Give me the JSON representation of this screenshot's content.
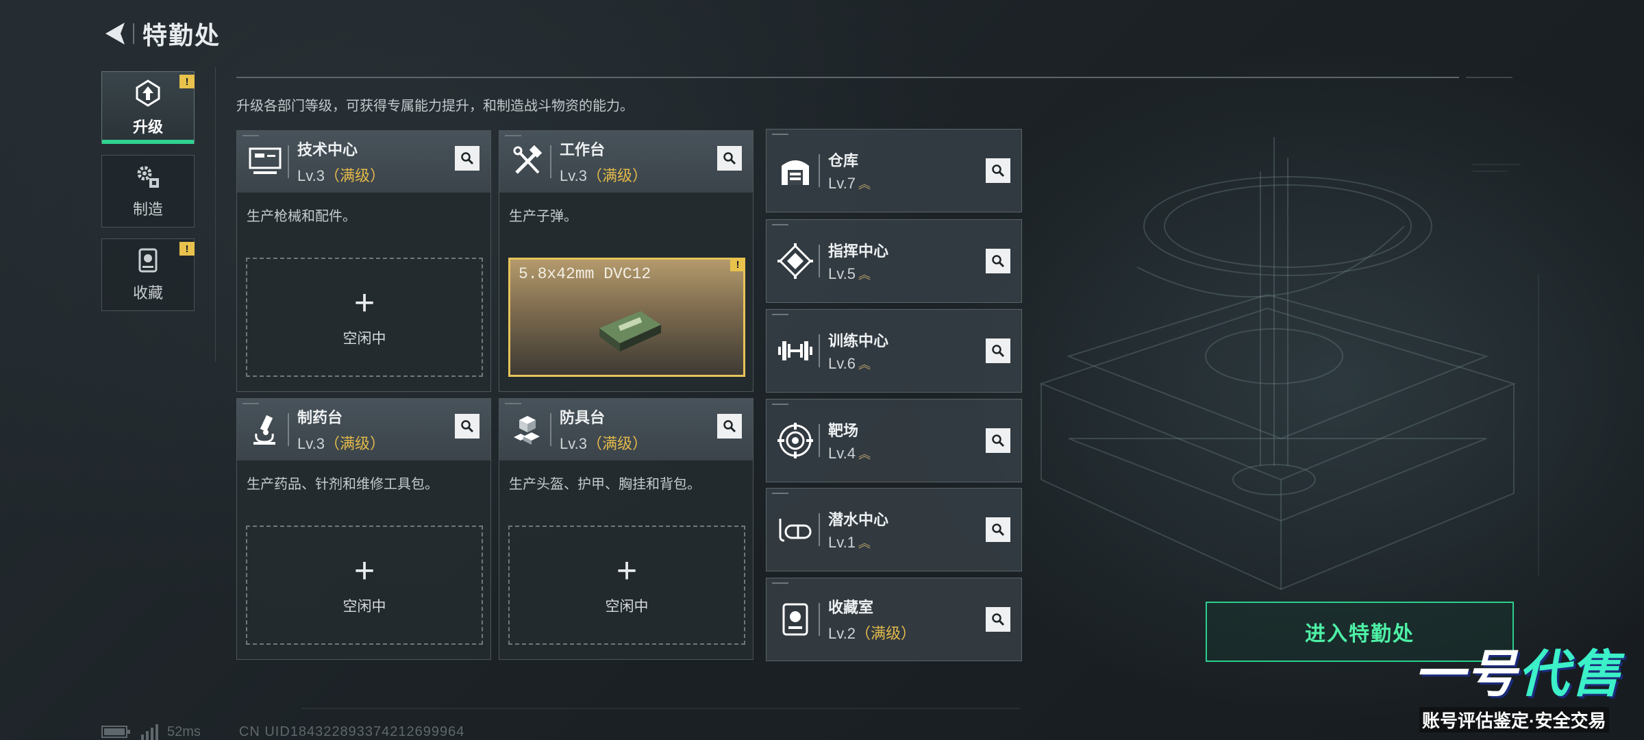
{
  "header": {
    "title": "特勤处"
  },
  "tabs": [
    {
      "label": "升级",
      "icon": "upgrade-icon",
      "active": true,
      "alert": true
    },
    {
      "label": "制造",
      "icon": "gears-icon",
      "active": false,
      "alert": false
    },
    {
      "label": "收藏",
      "icon": "collection-icon",
      "active": false,
      "alert": true
    }
  ],
  "alert_mark": "!",
  "description": "升级各部门等级，可获得专属能力提升，和制造战斗物资的能力。",
  "facilities": [
    {
      "name": "技术中心",
      "level": "Lv.3",
      "max": "（满级）",
      "desc": "生产枪械和配件。",
      "icon": "computer-icon",
      "slot_status": "空闲中"
    },
    {
      "name": "工作台",
      "level": "Lv.3",
      "max": "（满级）",
      "desc": "生产子弹。",
      "icon": "tools-icon",
      "slot_item": "5.8x42mm DVC12"
    },
    {
      "name": "制药台",
      "level": "Lv.3",
      "max": "（满级）",
      "desc": "生产药品、针剂和维修工具包。",
      "icon": "microscope-icon",
      "slot_status": "空闲中"
    },
    {
      "name": "防具台",
      "level": "Lv.3",
      "max": "（满级）",
      "desc": "生产头盔、护甲、胸挂和背包。",
      "icon": "armor-icon",
      "slot_status": "空闲中"
    }
  ],
  "slot_plus": "+",
  "departments": [
    {
      "name": "仓库",
      "level": "Lv.7",
      "max": "",
      "icon": "warehouse-icon"
    },
    {
      "name": "指挥中心",
      "level": "Lv.5",
      "max": "",
      "icon": "command-icon"
    },
    {
      "name": "训练中心",
      "level": "Lv.6",
      "max": "",
      "icon": "dumbbell-icon"
    },
    {
      "name": "靶场",
      "level": "Lv.4",
      "max": "",
      "icon": "target-icon"
    },
    {
      "name": "潜水中心",
      "level": "Lv.1",
      "max": "",
      "icon": "diving-mask-icon"
    },
    {
      "name": "收藏室",
      "level": "Lv.2",
      "max": "（满级）",
      "icon": "collection-room-icon"
    }
  ],
  "upgrade_chevron": "︽",
  "enter_button": "进入特勤处",
  "watermark": {
    "main_a": "一号",
    "main_b": "代售",
    "sub": "账号评估鉴定·安全交易"
  },
  "status": {
    "ping": "52ms",
    "uid": "CN UID1843228933742126999​64"
  },
  "colors": {
    "accent": "#2fd28f",
    "max_level": "#e3b94a",
    "alert": "#e8c24c"
  }
}
